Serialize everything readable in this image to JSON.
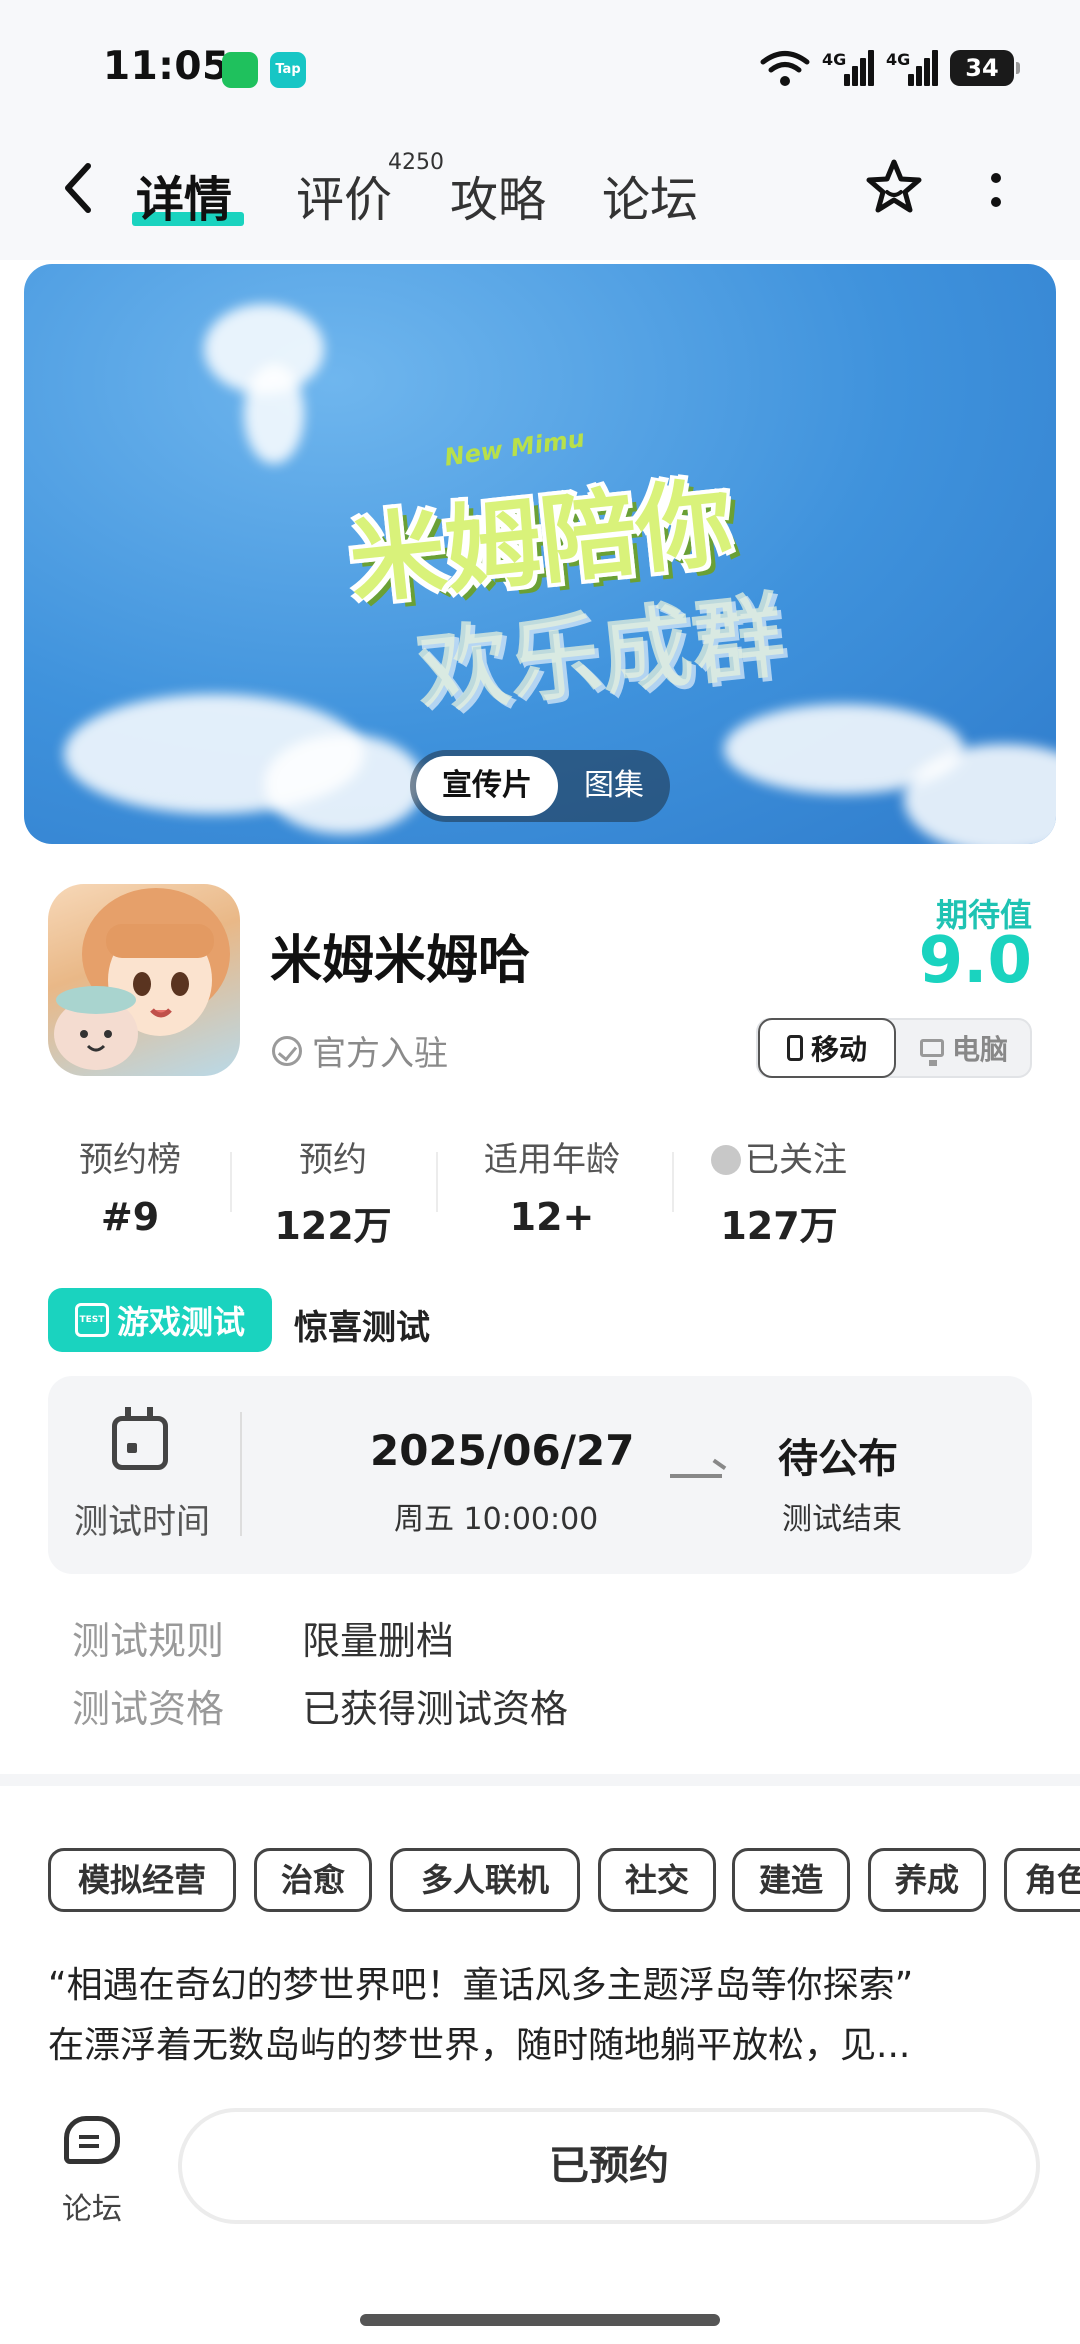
{
  "status_bar": {
    "time": "11:05",
    "tap_label": "Tap",
    "signal_label": "4G",
    "battery": "34"
  },
  "nav": {
    "tabs": [
      {
        "label": "详情"
      },
      {
        "label": "评价"
      },
      {
        "label": "攻略"
      },
      {
        "label": "论坛"
      }
    ],
    "review_count": "4250"
  },
  "banner": {
    "subtitle": "New Mimu",
    "line1": "米姆陪你",
    "line2": "欢乐成群",
    "segment": {
      "active": "宣传片",
      "inactive": "图集"
    }
  },
  "game": {
    "name": "米姆米姆哈",
    "verified": "官方入驻",
    "expect_label": "期待值",
    "expect_score": "9.0",
    "platforms": {
      "active": "移动",
      "inactive": "电脑"
    }
  },
  "stats": [
    {
      "key": "预约榜",
      "value": "#9"
    },
    {
      "key": "预约",
      "value": "122万"
    },
    {
      "key": "适用年龄",
      "value": "12+"
    },
    {
      "key": "已关注",
      "value": "127万"
    }
  ],
  "test": {
    "tag": "游戏测试",
    "tag_icon_text": "TEST",
    "type": "惊喜测试",
    "time_label": "测试时间",
    "start_date": "2025/06/27",
    "start_sub": "周五  10:00:00",
    "end_value": "待公布",
    "end_sub": "测试结束",
    "rules": [
      {
        "key": "测试规则",
        "value": "限量删档"
      },
      {
        "key": "测试资格",
        "value": "已获得测试资格"
      }
    ]
  },
  "tags": [
    "模拟经营",
    "治愈",
    "多人联机",
    "社交",
    "建造",
    "养成",
    "角色"
  ],
  "description": [
    "“相遇在奇幻的梦世界吧！童话风多主题浮岛等你探索”",
    "在漂浮着无数岛屿的梦世界，随时随地躺平放松，见..."
  ],
  "bottom": {
    "forum_label": "论坛",
    "reserve_button": "已预约"
  },
  "colors": {
    "accent": "#1ad3bf",
    "background": "#ffffff"
  }
}
